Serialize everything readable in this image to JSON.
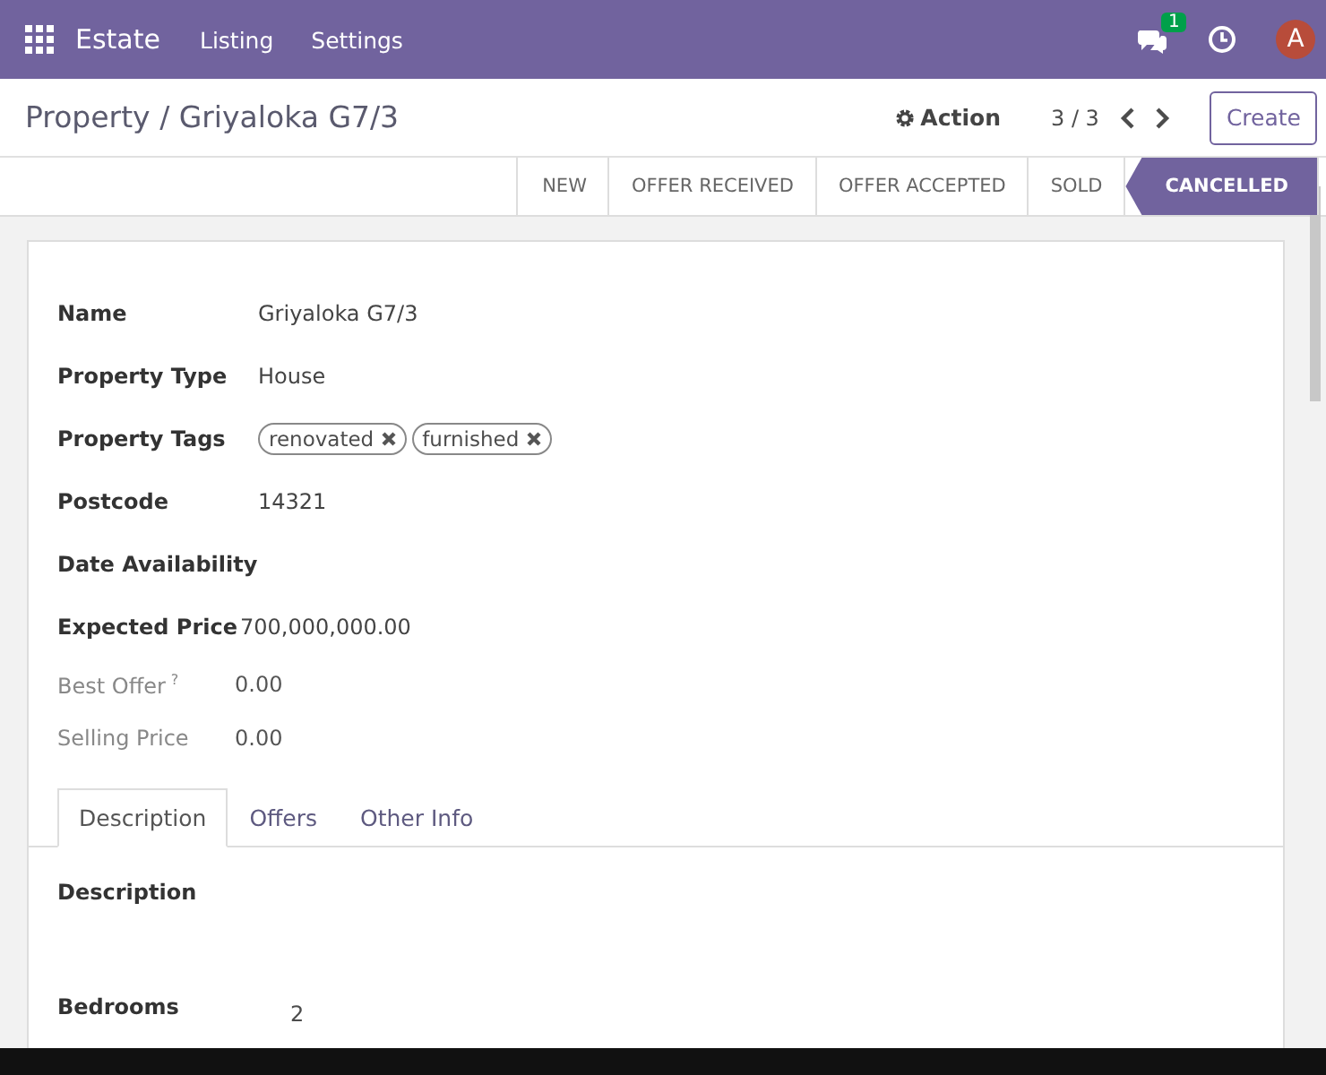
{
  "navbar": {
    "app": "Estate",
    "menus": [
      "Listing",
      "Settings"
    ],
    "messages_badge": "1",
    "avatar": "A"
  },
  "control_panel": {
    "breadcrumb": "Property / Griyaloka G7/3",
    "action": "Action",
    "pager": "3 / 3",
    "create": "Create"
  },
  "statusbar": [
    {
      "label": "NEW",
      "selected": false
    },
    {
      "label": "OFFER RECEIVED",
      "selected": false
    },
    {
      "label": "OFFER ACCEPTED",
      "selected": false
    },
    {
      "label": "SOLD",
      "selected": false
    },
    {
      "label": "CANCELLED",
      "selected": true
    }
  ],
  "fields": [
    {
      "kind": "text",
      "label": "Name",
      "value": "Griyaloka G7/3",
      "readonly": false
    },
    {
      "kind": "text",
      "label": "Property Type",
      "value": "House",
      "readonly": false
    },
    {
      "kind": "tags",
      "label": "Property Tags",
      "tags": [
        "renovated",
        "furnished"
      ],
      "readonly": false
    },
    {
      "kind": "text",
      "label": "Postcode",
      "value": "14321",
      "readonly": false
    },
    {
      "kind": "text",
      "label": "Date Availability",
      "readonly": false
    },
    {
      "kind": "text",
      "label": "Expected Price",
      "value": "700,000,000.00",
      "readonly": false
    },
    {
      "kind": "text",
      "label": "Best Offer",
      "help": "?",
      "value": "0.00",
      "readonly": true
    },
    {
      "kind": "text",
      "label": "Selling Price",
      "value": "0.00",
      "readonly": true
    }
  ],
  "notebook": {
    "tabs": [
      {
        "label": "Description",
        "selected": true
      },
      {
        "label": "Offers",
        "selected": false
      },
      {
        "label": "Other Info",
        "selected": false
      }
    ],
    "fields": [
      {
        "label": "Description"
      },
      {
        "label": "Bedrooms",
        "value": "2"
      }
    ]
  }
}
